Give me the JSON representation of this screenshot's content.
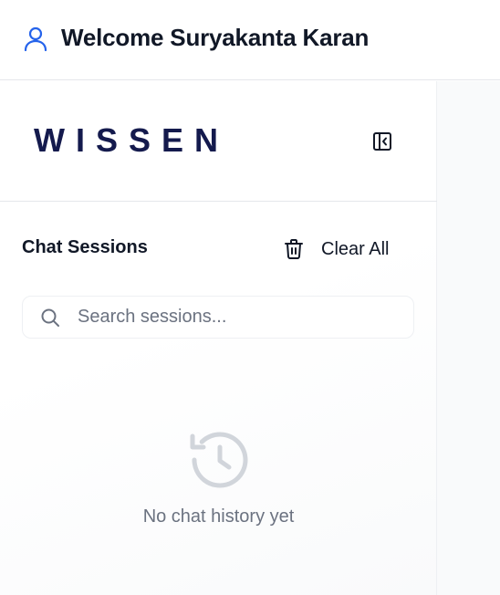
{
  "header": {
    "welcome_text": "Welcome Suryakanta Karan",
    "user_icon": "user-icon"
  },
  "sidebar": {
    "logo_text": "WISSEN",
    "collapse_icon": "panel-collapse-icon",
    "sessions_title": "Chat Sessions",
    "clear_all_label": "Clear All",
    "clear_all_icon": "trash-icon",
    "search": {
      "placeholder": "Search sessions...",
      "value": "",
      "icon": "search-icon"
    },
    "empty_state": {
      "icon": "history-icon",
      "text": "No chat history yet"
    }
  },
  "colors": {
    "accent_blue": "#2563eb",
    "logo_navy": "#141a4d",
    "text_primary": "#111827",
    "text_muted": "#6b7280",
    "empty_icon_gray": "#d1d5db"
  }
}
